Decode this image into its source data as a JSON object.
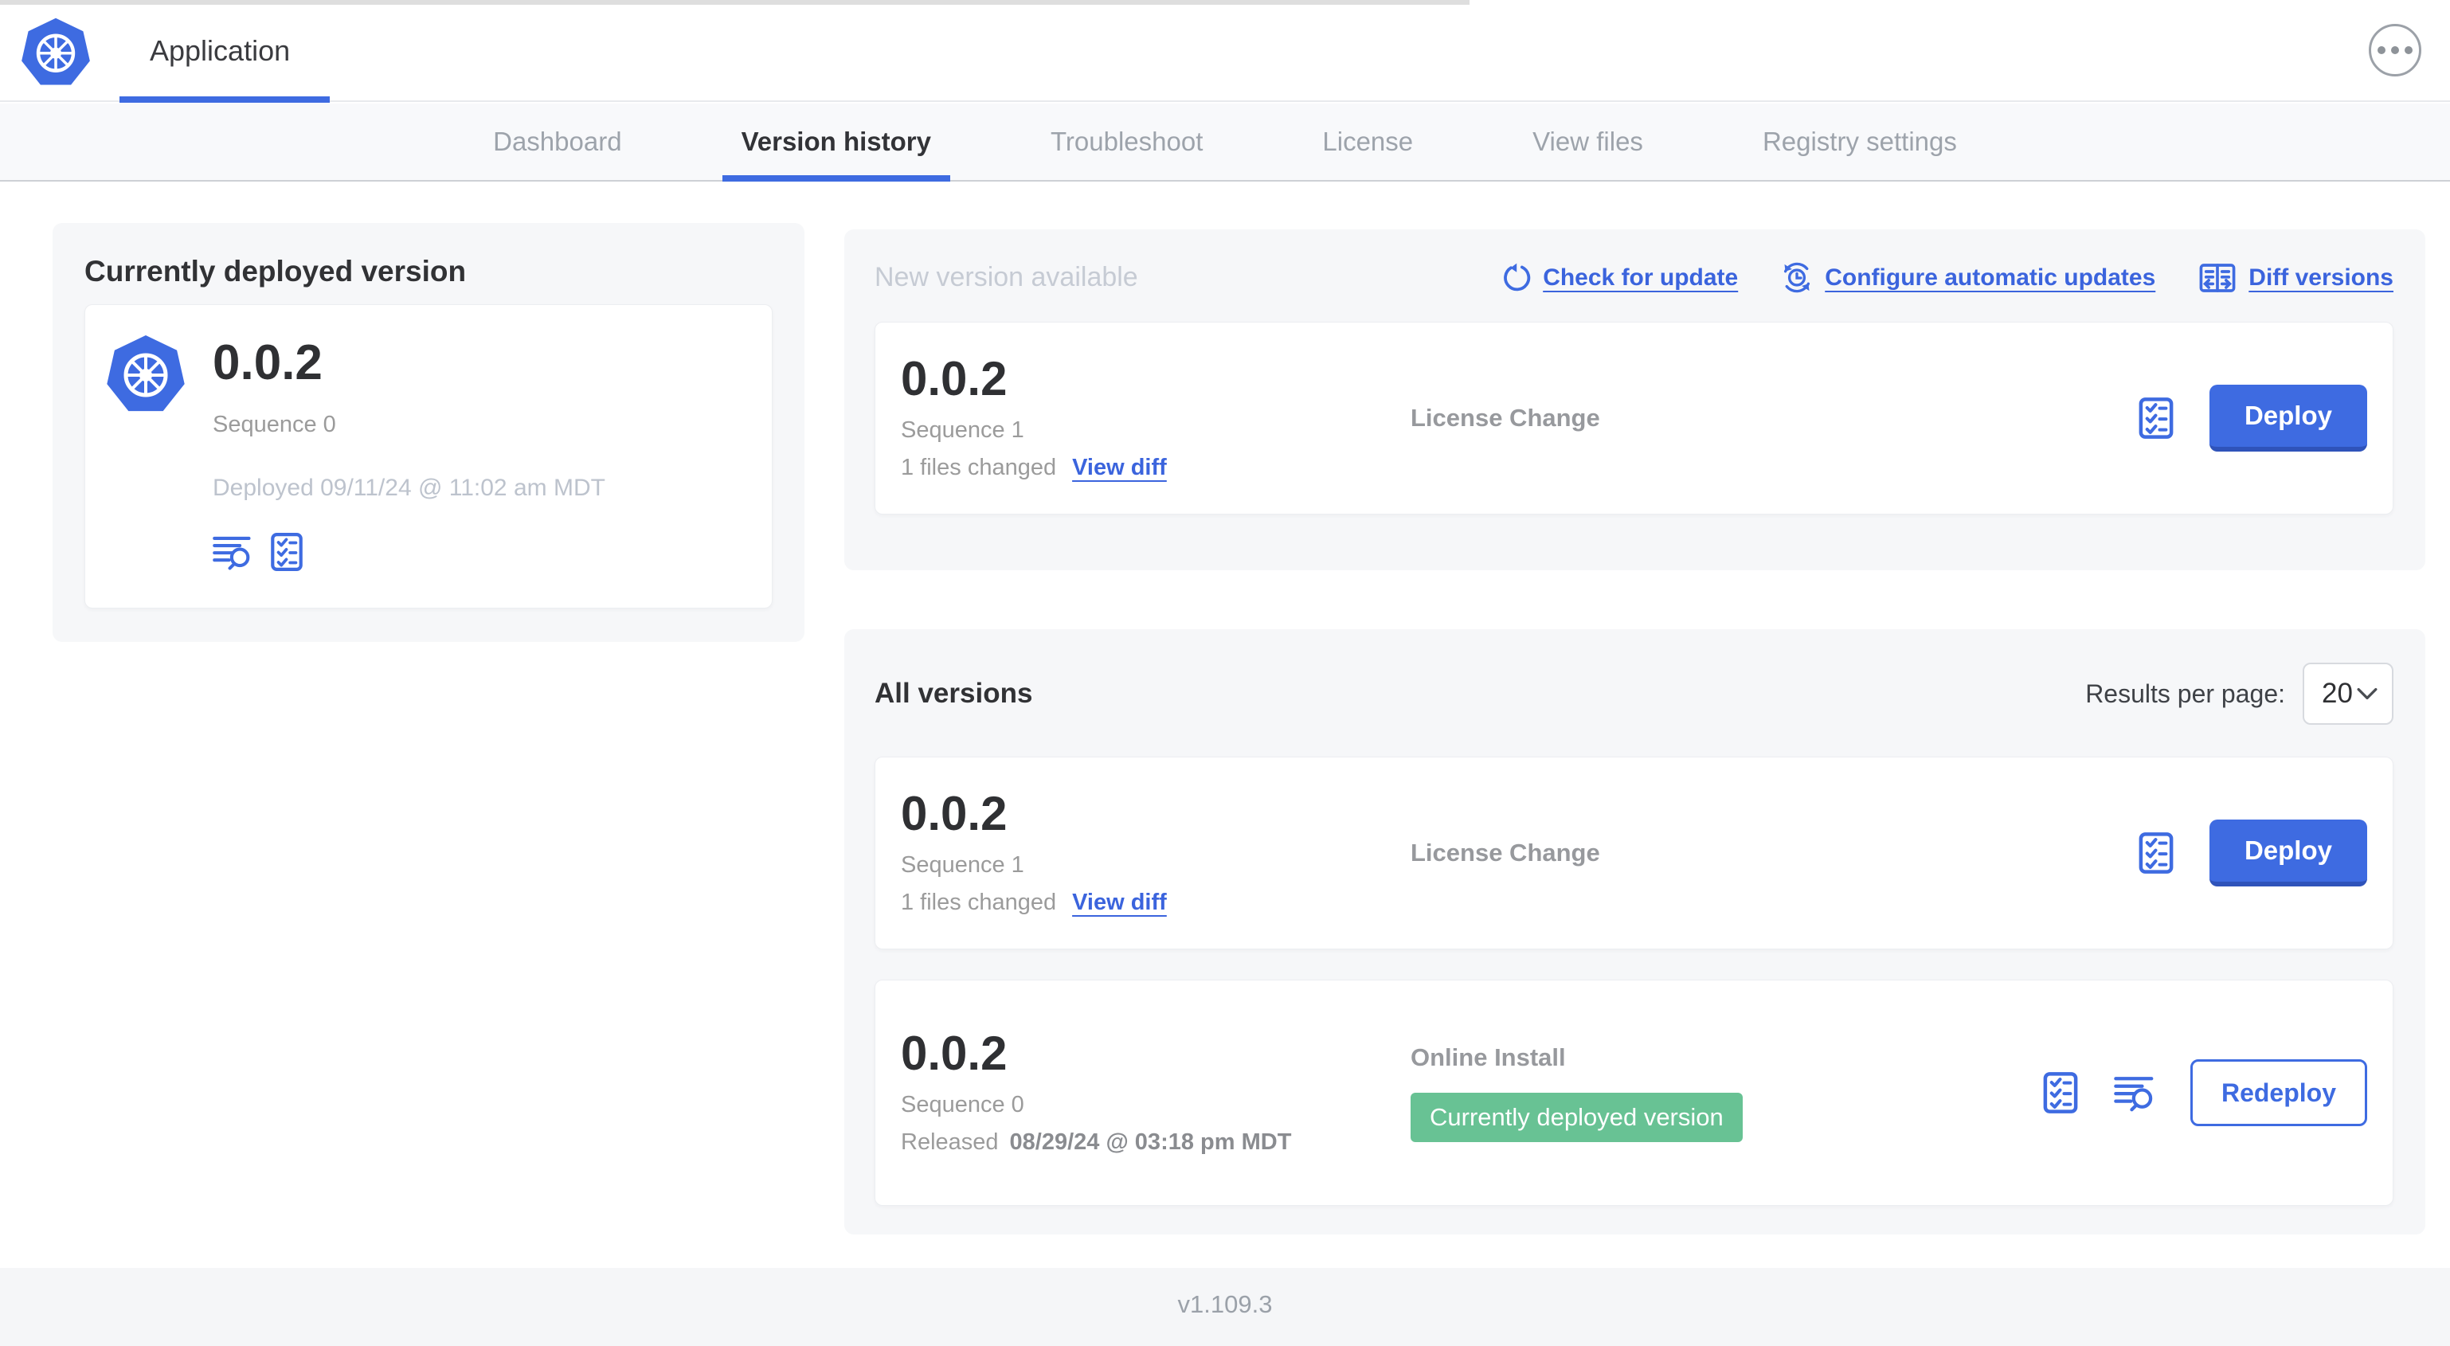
{
  "colors": {
    "accent": "#3e6be1",
    "accent_dark": "#2f53ba",
    "green_badge": "#68c294"
  },
  "header": {
    "app_tab": "Application",
    "more_menu_icon": "kebab-menu-icon"
  },
  "nav": {
    "tabs": [
      "Dashboard",
      "Version history",
      "Troubleshoot",
      "License",
      "View files",
      "Registry settings"
    ],
    "active_tab": "Version history"
  },
  "current_card": {
    "title": "Currently deployed version",
    "app_icon": "kubernetes-logo-icon",
    "version": "0.0.2",
    "sequence": "Sequence 0",
    "deployed_at": "Deployed 09/11/24 @ 11:02 am MDT",
    "icons": [
      "view-logs-icon",
      "preflight-checks-icon"
    ]
  },
  "new_version_section": {
    "title": "New version available",
    "actions": [
      {
        "label": "Check for update",
        "icon": "refresh-icon"
      },
      {
        "label": "Configure automatic updates",
        "icon": "auto-update-icon"
      },
      {
        "label": "Diff versions",
        "icon": "diff-icon"
      }
    ],
    "row": {
      "version": "0.0.2",
      "sequence": "Sequence 1",
      "files_changed": "1 files changed",
      "view_diff_label": "View diff",
      "source": "License Change",
      "icons": [
        "preflight-checks-icon"
      ],
      "action_label": "Deploy"
    }
  },
  "all_versions_section": {
    "title": "All versions",
    "results_per_page_label": "Results per page:",
    "results_per_page_value": "20",
    "rows": [
      {
        "version": "0.0.2",
        "sequence": "Sequence 1",
        "files_changed": "1 files changed",
        "view_diff_label": "View diff",
        "source": "License Change",
        "icons": [
          "preflight-checks-icon"
        ],
        "action_label": "Deploy"
      },
      {
        "version": "0.0.2",
        "sequence": "Sequence 0",
        "released_label": "Released",
        "released_date": "08/29/24 @ 03:18 pm MDT",
        "source": "Online Install",
        "badge": "Currently deployed version",
        "icons": [
          "preflight-checks-icon",
          "view-logs-icon"
        ],
        "action_label": "Redeploy"
      }
    ]
  },
  "footer": {
    "version_label": "v1.109.3"
  }
}
